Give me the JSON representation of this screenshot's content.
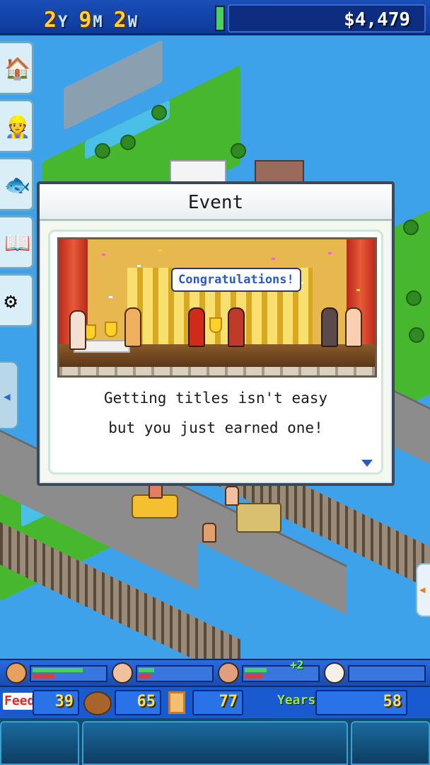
{
  "header": {
    "years_value": "2",
    "years_unit": "Y",
    "months_value": "9",
    "months_unit": "M",
    "weeks_value": "2",
    "weeks_unit": "W",
    "funds": "$4,479"
  },
  "side_menu": {
    "items": [
      {
        "icon": "build-icon"
      },
      {
        "icon": "staff-icon"
      },
      {
        "icon": "fish-icon"
      },
      {
        "icon": "book-icon"
      },
      {
        "icon": "settings-icon"
      }
    ]
  },
  "event_dialog": {
    "title": "Event",
    "scene_caption": "Congratulations!",
    "message_line1": "Getting titles isn't easy",
    "message_line2": "but you just earned one!"
  },
  "staff_bar": {
    "bonus": "+2",
    "members": [
      {
        "hp_pct": 70,
        "mp_pct": 30
      },
      {
        "hp_pct": 22,
        "mp_pct": 18
      },
      {
        "hp_pct": 30,
        "mp_pct": 25
      },
      {
        "hp_pct": 0,
        "mp_pct": 0
      }
    ]
  },
  "stats": {
    "feed_label": "Feed",
    "feed_value": "39",
    "wood_value": "65",
    "door_value": "77",
    "years_label": "Years",
    "years_value": "58"
  },
  "colors": {
    "accent_blue": "#1a4fb8",
    "money_text": "#ffffff",
    "date_numbers": "#ffd040",
    "stat_numbers": "#f4e060",
    "speech_text": "#2a5ac8"
  }
}
